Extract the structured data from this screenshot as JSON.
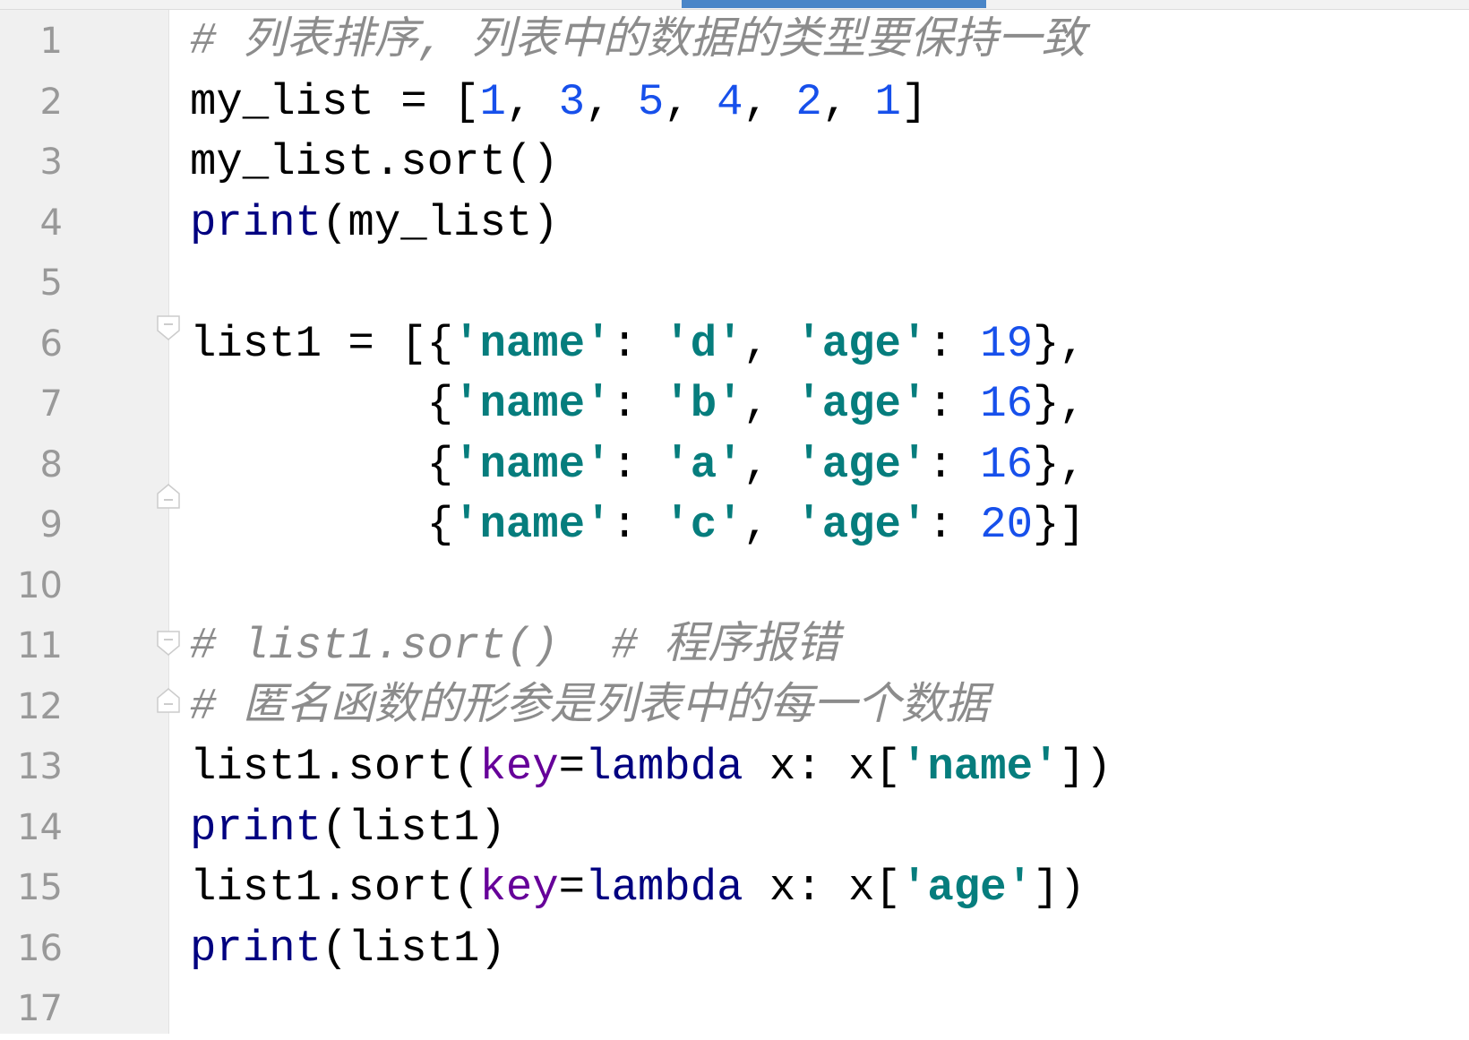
{
  "editor": {
    "line_numbers": [
      "1",
      "2",
      "3",
      "4",
      "5",
      "6",
      "7",
      "8",
      "9",
      "10",
      "11",
      "12",
      "13",
      "14",
      "15",
      "16",
      "17"
    ],
    "lines": [
      [
        {
          "t": "# 列表排序, 列表中的数据的类型要保持一致",
          "c": "comment"
        }
      ],
      [
        {
          "t": "my_list = [",
          "c": "plain"
        },
        {
          "t": "1",
          "c": "num"
        },
        {
          "t": ", ",
          "c": "plain"
        },
        {
          "t": "3",
          "c": "num"
        },
        {
          "t": ", ",
          "c": "plain"
        },
        {
          "t": "5",
          "c": "num"
        },
        {
          "t": ", ",
          "c": "plain"
        },
        {
          "t": "4",
          "c": "num"
        },
        {
          "t": ", ",
          "c": "plain"
        },
        {
          "t": "2",
          "c": "num"
        },
        {
          "t": ", ",
          "c": "plain"
        },
        {
          "t": "1",
          "c": "num"
        },
        {
          "t": "]",
          "c": "plain"
        }
      ],
      [
        {
          "t": "my_list.sort()",
          "c": "plain"
        }
      ],
      [
        {
          "t": "print",
          "c": "kw"
        },
        {
          "t": "(my_list)",
          "c": "plain"
        }
      ],
      [],
      [
        {
          "t": "list1 = [{",
          "c": "plain"
        },
        {
          "t": "'name'",
          "c": "str"
        },
        {
          "t": ": ",
          "c": "plain"
        },
        {
          "t": "'d'",
          "c": "str"
        },
        {
          "t": ", ",
          "c": "plain"
        },
        {
          "t": "'age'",
          "c": "str"
        },
        {
          "t": ": ",
          "c": "plain"
        },
        {
          "t": "19",
          "c": "num"
        },
        {
          "t": "},",
          "c": "plain"
        }
      ],
      [
        {
          "t": "         {",
          "c": "plain"
        },
        {
          "t": "'name'",
          "c": "str"
        },
        {
          "t": ": ",
          "c": "plain"
        },
        {
          "t": "'b'",
          "c": "str"
        },
        {
          "t": ", ",
          "c": "plain"
        },
        {
          "t": "'age'",
          "c": "str"
        },
        {
          "t": ": ",
          "c": "plain"
        },
        {
          "t": "16",
          "c": "num"
        },
        {
          "t": "},",
          "c": "plain"
        }
      ],
      [
        {
          "t": "         {",
          "c": "plain"
        },
        {
          "t": "'name'",
          "c": "str"
        },
        {
          "t": ": ",
          "c": "plain"
        },
        {
          "t": "'a'",
          "c": "str"
        },
        {
          "t": ", ",
          "c": "plain"
        },
        {
          "t": "'age'",
          "c": "str"
        },
        {
          "t": ": ",
          "c": "plain"
        },
        {
          "t": "16",
          "c": "num"
        },
        {
          "t": "},",
          "c": "plain"
        }
      ],
      [
        {
          "t": "         {",
          "c": "plain"
        },
        {
          "t": "'name'",
          "c": "str"
        },
        {
          "t": ": ",
          "c": "plain"
        },
        {
          "t": "'c'",
          "c": "str"
        },
        {
          "t": ", ",
          "c": "plain"
        },
        {
          "t": "'age'",
          "c": "str"
        },
        {
          "t": ": ",
          "c": "plain"
        },
        {
          "t": "20",
          "c": "num"
        },
        {
          "t": "}]",
          "c": "plain"
        }
      ],
      [],
      [
        {
          "t": "# list1.sort()  # 程序报错",
          "c": "comment"
        }
      ],
      [
        {
          "t": "# 匿名函数的形参是列表中的每一个数据",
          "c": "comment"
        }
      ],
      [
        {
          "t": "list1.sort(",
          "c": "plain"
        },
        {
          "t": "key",
          "c": "param"
        },
        {
          "t": "=",
          "c": "plain"
        },
        {
          "t": "lambda",
          "c": "kw"
        },
        {
          "t": " x: x[",
          "c": "plain"
        },
        {
          "t": "'name'",
          "c": "str"
        },
        {
          "t": "])",
          "c": "plain"
        }
      ],
      [
        {
          "t": "print",
          "c": "kw"
        },
        {
          "t": "(list1)",
          "c": "plain"
        }
      ],
      [
        {
          "t": "list1.sort(",
          "c": "plain"
        },
        {
          "t": "key",
          "c": "param"
        },
        {
          "t": "=",
          "c": "plain"
        },
        {
          "t": "lambda",
          "c": "kw"
        },
        {
          "t": " x: x[",
          "c": "plain"
        },
        {
          "t": "'age'",
          "c": "str"
        },
        {
          "t": "])",
          "c": "plain"
        }
      ],
      [
        {
          "t": "print",
          "c": "kw"
        },
        {
          "t": "(list1)",
          "c": "plain"
        }
      ],
      []
    ]
  }
}
